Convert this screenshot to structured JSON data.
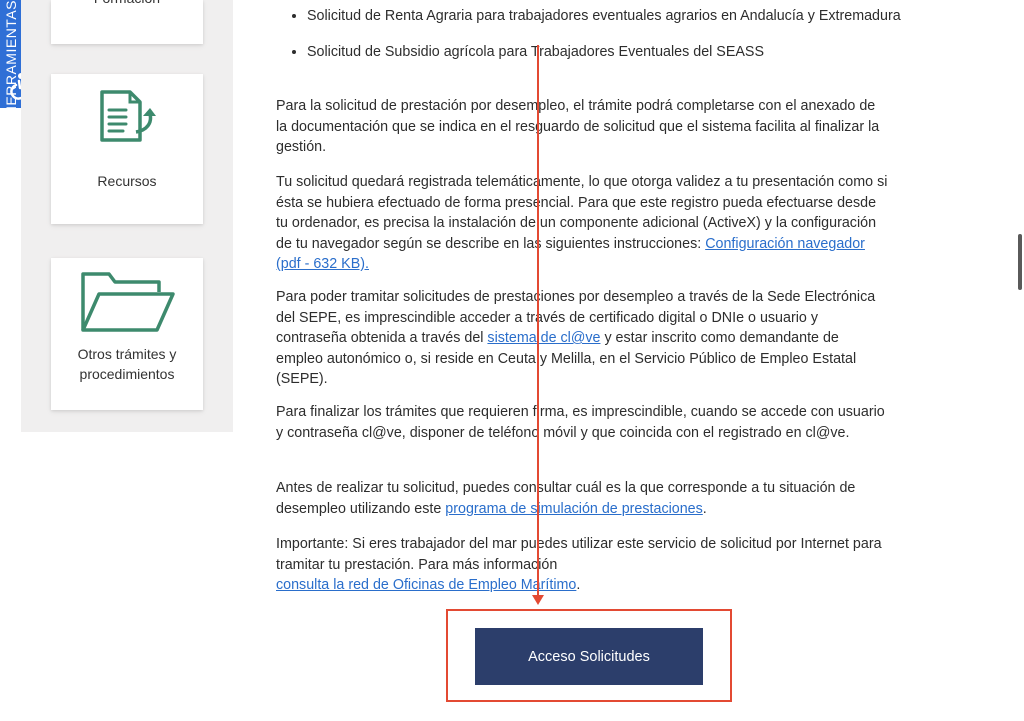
{
  "accessibility_tab": {
    "label": "HERRAMIENTAS\nACCESIBILIDAD"
  },
  "sidebar": {
    "cards": [
      {
        "label": "Formación",
        "icon": "training-icon"
      },
      {
        "label": "Recursos",
        "icon": "document-reply-icon"
      },
      {
        "label": "Otros trámites y procedimientos",
        "icon": "folder-icon"
      }
    ]
  },
  "content": {
    "bullets": [
      "Solicitud de Renta Agraria para trabajadores eventuales agrarios en Andalucía y Extremadura",
      "Solicitud de Subsidio agrícola para Trabajadores Eventuales del SEASS"
    ],
    "p1": "Para la solicitud de prestación por desempleo, el trámite podrá completarse con el anexado de la documentación que se indica en el resguardo de solicitud que el sistema facilita al finalizar la gestión.",
    "p2_text": "Tu solicitud quedará registrada telemáticamente, lo que otorga validez a tu presentación como si ésta se hubiera efectuado de forma presencial. Para que este registro pueda efectuarse desde tu ordenador, es precisa la instalación de un componente adicional (ActiveX) y la configuración de tu navegador según se describe en las siguientes instrucciones: ",
    "p2_link": "Configuración navegador (pdf - 632 KB).",
    "p3_text_a": "Para poder tramitar solicitudes de prestaciones por desempleo a través de la Sede Electrónica del SEPE, es imprescindible acceder a través de certificado digital o DNIe o usuario y contraseña obtenida a través del ",
    "p3_link": "sistema de cl@ve",
    "p3_text_b": " y estar inscrito como demandante de empleo autonómico o, si reside en Ceuta y Melilla, en el Servicio Público de Empleo Estatal (SEPE).",
    "p4": "Para finalizar los trámites que requieren firma, es imprescindible, cuando se accede con usuario y contraseña cl@ve, disponer de teléfono móvil y que coincida con el registrado en cl@ve.",
    "p5_text": "Antes de realizar tu solicitud, puedes consultar cuál es la que corresponde a tu situación de desempleo utilizando este ",
    "p5_link": "programa de simulación de prestaciones",
    "p5_end": ".",
    "p6_text": "Importante: Si eres trabajador del mar puedes utilizar este servicio de solicitud por Internet para tramitar tu prestación. Para más información",
    "p6_link": "consulta la red de Oficinas de Empleo Marítimo",
    "p6_end": "."
  },
  "access_button": {
    "label": "Acceso Solicitudes"
  },
  "colors": {
    "accent_blue": "#2f6fd6",
    "button_navy": "#2c3e6b",
    "annotation_red": "#e34a33",
    "link": "#2a6ecb",
    "icon_green": "#3d8a6d"
  }
}
